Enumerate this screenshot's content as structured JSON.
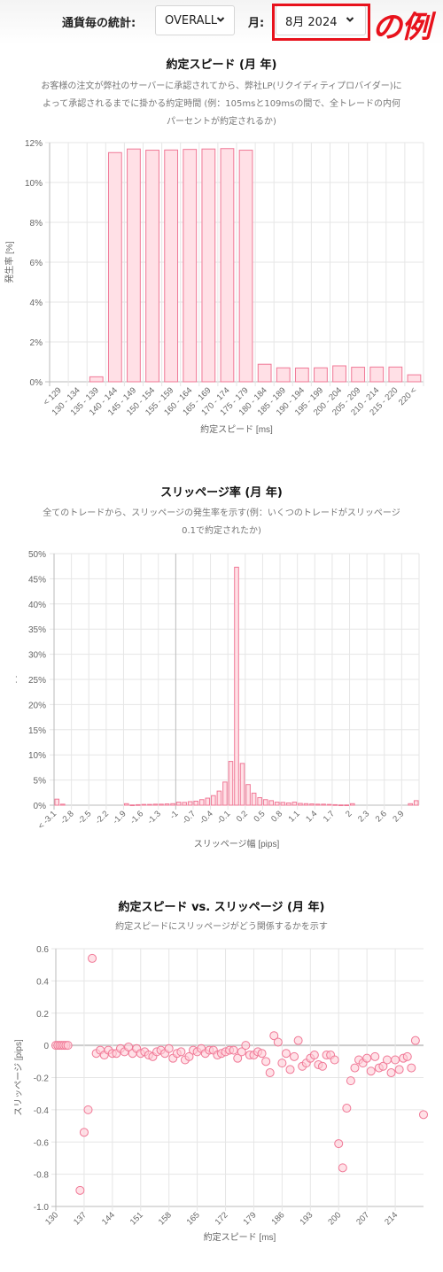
{
  "header": {
    "stats_label": "通貨毎の統計:",
    "currency_select": {
      "value": "OVERALL"
    },
    "month_label": "月:",
    "month_select": {
      "value": "8月 2024"
    },
    "annotation": "の例",
    "highlight_color": "#e8121c"
  },
  "colors": {
    "bar_fill": "#ffe0e6",
    "bar_stroke": "#f07896",
    "grid": "#e6e6e6",
    "axis": "#bbbbbb"
  },
  "charts": {
    "speed": {
      "title": "約定スピード (月 年)",
      "description_lines": [
        "お客様の注文が弊社のサーバーに承認されてから、弊社LP(リクイディティプロバイダー)に",
        "よって承認されるまでに掛かる約定時間 (例：105msと109msの間で、全トレードの内何",
        "パーセントが約定されるか)"
      ]
    },
    "slippage": {
      "title": "スリッページ率 (月 年)",
      "description_lines": [
        "全てのトレードから、スリッページの発生率を示す(例：いくつのトレードがスリッページ",
        "0.1で約定されたか)"
      ]
    },
    "scatter": {
      "title": "約定スピード vs. スリッページ (月 年)",
      "description_lines": [
        "約定スピードにスリッページがどう関係するかを示す"
      ]
    }
  },
  "chart_data": [
    {
      "type": "bar",
      "title": "約定スピード (月 年)",
      "xlabel": "約定スピード [ms]",
      "ylabel": "発生率 [%]",
      "ylim": [
        0,
        12
      ],
      "yticks": [
        "0%",
        "2%",
        "4%",
        "6%",
        "8%",
        "10%",
        "12%"
      ],
      "grid": true,
      "categories": [
        "< 129",
        "130 - 134",
        "135 - 139",
        "140 - 144",
        "145 - 149",
        "150 - 154",
        "155 - 159",
        "160 - 164",
        "165 - 169",
        "170 - 174",
        "175 - 179",
        "180 - 184",
        "185 - 189",
        "190 - 194",
        "195 - 199",
        "200 - 204",
        "205 - 209",
        "210 - 214",
        "215 - 220",
        "220 <"
      ],
      "values": [
        0,
        0,
        0.25,
        11.5,
        11.68,
        11.62,
        11.63,
        11.66,
        11.68,
        11.7,
        11.62,
        0.88,
        0.7,
        0.69,
        0.7,
        0.8,
        0.73,
        0.74,
        0.74,
        0.35
      ]
    },
    {
      "type": "bar",
      "title": "スリッページ率 (月 年)",
      "xlabel": "スリッページ幅 [pips]",
      "ylabel": "",
      "ylim": [
        0,
        50
      ],
      "yticks": [
        "0%",
        "5%",
        "10%",
        "15%",
        "20%",
        "25%",
        "30%",
        "35%",
        "40%",
        "45%",
        "50%"
      ],
      "grid": true,
      "xtick_labels": [
        "< -3.1",
        "-2.8",
        "-2.5",
        "-2.2",
        "-1.9",
        "-1.6",
        "-1.3",
        "-1",
        "-0.7",
        "-0.4",
        "-0.1",
        "0.2",
        "0.5",
        "0.8",
        "1.1",
        "1.4",
        "1.7",
        "2",
        "2.3",
        "2.6",
        "2.9"
      ],
      "categories": [
        "< -3.1",
        "-3",
        "-2.9",
        "-2.8",
        "-2.7",
        "-2.6",
        "-2.5",
        "-2.4",
        "-2.3",
        "-2.2",
        "-2.1",
        "-2",
        "-1.9",
        "-1.8",
        "-1.7",
        "-1.6",
        "-1.5",
        "-1.4",
        "-1.3",
        "-1.2",
        "-1.1",
        "-1",
        "-0.9",
        "-0.8",
        "-0.7",
        "-0.6",
        "-0.5",
        "-0.4",
        "-0.3",
        "-0.2",
        "-0.1",
        "0",
        "0.1",
        "0.2",
        "0.3",
        "0.4",
        "0.5",
        "0.6",
        "0.7",
        "0.8",
        "0.9",
        "1",
        "1.1",
        "1.2",
        "1.3",
        "1.4",
        "1.5",
        "1.6",
        "1.7",
        "1.8",
        "1.9",
        "2",
        "2.1",
        "2.2",
        "2.3",
        "2.4",
        "2.5",
        "2.6",
        "2.7",
        "2.8",
        "2.9",
        "3",
        "3.1 <"
      ],
      "values": [
        1.2,
        0.2,
        0,
        0,
        0,
        0,
        0,
        0,
        0,
        0,
        0,
        0,
        0.3,
        0.05,
        0.1,
        0.15,
        0.15,
        0.2,
        0.2,
        0.25,
        0.3,
        0.6,
        0.55,
        0.7,
        0.8,
        1.1,
        1.4,
        1.9,
        2.8,
        4.6,
        8.7,
        47.3,
        8.3,
        4.1,
        2.4,
        1.5,
        1.1,
        0.9,
        0.6,
        0.55,
        0.45,
        0.6,
        0.35,
        0.3,
        0.25,
        0.2,
        0.2,
        0.15,
        0.1,
        0.05,
        0.05,
        0.3,
        0,
        0,
        0,
        0,
        0,
        0,
        0,
        0,
        0,
        0.3,
        0.9
      ]
    },
    {
      "type": "scatter",
      "title": "約定スピード vs. スリッページ (月 年)",
      "xlabel": "約定スピード [ms]",
      "ylabel": "スリッページ [pips]",
      "xlim": [
        130,
        221
      ],
      "ylim": [
        -1.0,
        0.6
      ],
      "xticks": [
        130,
        137,
        144,
        151,
        158,
        165,
        172,
        179,
        186,
        193,
        200,
        207,
        214
      ],
      "yticks": [
        "0.6",
        "0.4",
        "0.2",
        "0",
        "-0.2",
        "-0.4",
        "-0.6",
        "-0.8",
        "-1.0"
      ],
      "grid": true,
      "points": [
        [
          130,
          0
        ],
        [
          130.5,
          0
        ],
        [
          131,
          0
        ],
        [
          131.5,
          0
        ],
        [
          132,
          0
        ],
        [
          132.5,
          0
        ],
        [
          133,
          0
        ],
        [
          136,
          -0.9
        ],
        [
          137,
          -0.54
        ],
        [
          138,
          -0.4
        ],
        [
          139,
          0.54
        ],
        [
          140,
          -0.05
        ],
        [
          141,
          -0.03
        ],
        [
          142,
          -0.06
        ],
        [
          143,
          -0.03
        ],
        [
          144,
          -0.05
        ],
        [
          145,
          -0.05
        ],
        [
          146,
          -0.02
        ],
        [
          147,
          -0.04
        ],
        [
          148,
          -0.01
        ],
        [
          149,
          -0.05
        ],
        [
          150,
          -0.02
        ],
        [
          151,
          -0.05
        ],
        [
          152,
          -0.04
        ],
        [
          153,
          -0.06
        ],
        [
          154,
          -0.07
        ],
        [
          155,
          -0.04
        ],
        [
          156,
          -0.03
        ],
        [
          157,
          -0.05
        ],
        [
          158,
          -0.02
        ],
        [
          159,
          -0.08
        ],
        [
          160,
          -0.05
        ],
        [
          161,
          -0.04
        ],
        [
          162,
          -0.09
        ],
        [
          163,
          -0.07
        ],
        [
          164,
          -0.03
        ],
        [
          165,
          -0.04
        ],
        [
          166,
          -0.02
        ],
        [
          167,
          -0.05
        ],
        [
          168,
          -0.03
        ],
        [
          169,
          -0.03
        ],
        [
          170,
          -0.06
        ],
        [
          171,
          -0.05
        ],
        [
          172,
          -0.04
        ],
        [
          173,
          -0.03
        ],
        [
          174,
          -0.03
        ],
        [
          175,
          -0.08
        ],
        [
          176,
          -0.04
        ],
        [
          177,
          0
        ],
        [
          178,
          -0.06
        ],
        [
          179,
          -0.06
        ],
        [
          180,
          -0.04
        ],
        [
          181,
          -0.05
        ],
        [
          182,
          -0.1
        ],
        [
          183,
          -0.17
        ],
        [
          184,
          0.06
        ],
        [
          185,
          0.02
        ],
        [
          186,
          -0.11
        ],
        [
          187,
          -0.05
        ],
        [
          188,
          -0.15
        ],
        [
          189,
          -0.07
        ],
        [
          190,
          0.03
        ],
        [
          191,
          -0.13
        ],
        [
          192,
          -0.11
        ],
        [
          193,
          -0.08
        ],
        [
          194,
          -0.06
        ],
        [
          195,
          -0.12
        ],
        [
          196,
          -0.13
        ],
        [
          197,
          -0.06
        ],
        [
          198,
          -0.06
        ],
        [
          199,
          -0.09
        ],
        [
          200,
          -0.61
        ],
        [
          201,
          -0.76
        ],
        [
          202,
          -0.39
        ],
        [
          203,
          -0.22
        ],
        [
          204,
          -0.14
        ],
        [
          205,
          -0.09
        ],
        [
          206,
          -0.11
        ],
        [
          207,
          -0.08
        ],
        [
          208,
          -0.16
        ],
        [
          209,
          -0.07
        ],
        [
          210,
          -0.14
        ],
        [
          211,
          -0.13
        ],
        [
          212,
          -0.09
        ],
        [
          213,
          -0.17
        ],
        [
          214,
          -0.09
        ],
        [
          215,
          -0.15
        ],
        [
          216,
          -0.08
        ],
        [
          217,
          -0.07
        ],
        [
          218,
          -0.14
        ],
        [
          219,
          0.03
        ],
        [
          221,
          -0.43
        ]
      ]
    }
  ]
}
